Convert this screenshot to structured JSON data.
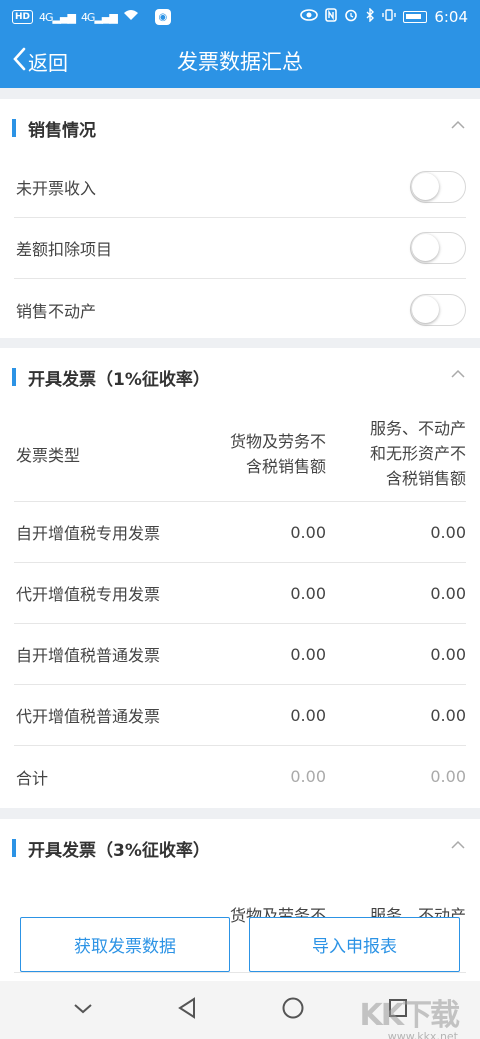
{
  "status_bar": {
    "time": "6:04",
    "network_1": "4G",
    "network_2": "4G",
    "hd": "HD"
  },
  "nav": {
    "back_label": "返回",
    "title": "发票数据汇总"
  },
  "sales": {
    "title": "销售情况",
    "items": [
      {
        "label": "未开票收入",
        "enabled": false
      },
      {
        "label": "差额扣除项目",
        "enabled": false
      },
      {
        "label": "销售不动产",
        "enabled": false
      }
    ]
  },
  "invoice_1pct": {
    "title": "开具发票（1%征收率）",
    "headers": {
      "type": "发票类型",
      "goods_line1": "货物及劳务不",
      "goods_line2": "含税销售额",
      "services_line1": "服务、不动产",
      "services_line2": "和无形资产不",
      "services_line3": "含税销售额"
    },
    "rows": [
      {
        "type": "自开增值税专用发票",
        "goods": "0.00",
        "services": "0.00"
      },
      {
        "type": "代开增值税专用发票",
        "goods": "0.00",
        "services": "0.00"
      },
      {
        "type": "自开增值税普通发票",
        "goods": "0.00",
        "services": "0.00"
      },
      {
        "type": "代开增值税普通发票",
        "goods": "0.00",
        "services": "0.00"
      },
      {
        "type": "合计",
        "goods": "0.00",
        "services": "0.00"
      }
    ]
  },
  "invoice_3pct": {
    "title": "开具发票（3%征收率）",
    "headers": {
      "goods_line1": "货物及劳务不",
      "services_line1": "服务、不动产"
    }
  },
  "actions": {
    "fetch_label": "获取发票数据",
    "import_label": "导入申报表"
  },
  "watermark": {
    "big": "KK下载",
    "small": "www.kkx.net"
  },
  "colors": {
    "accent": "#2c93e5",
    "background": "#eef0f3"
  }
}
